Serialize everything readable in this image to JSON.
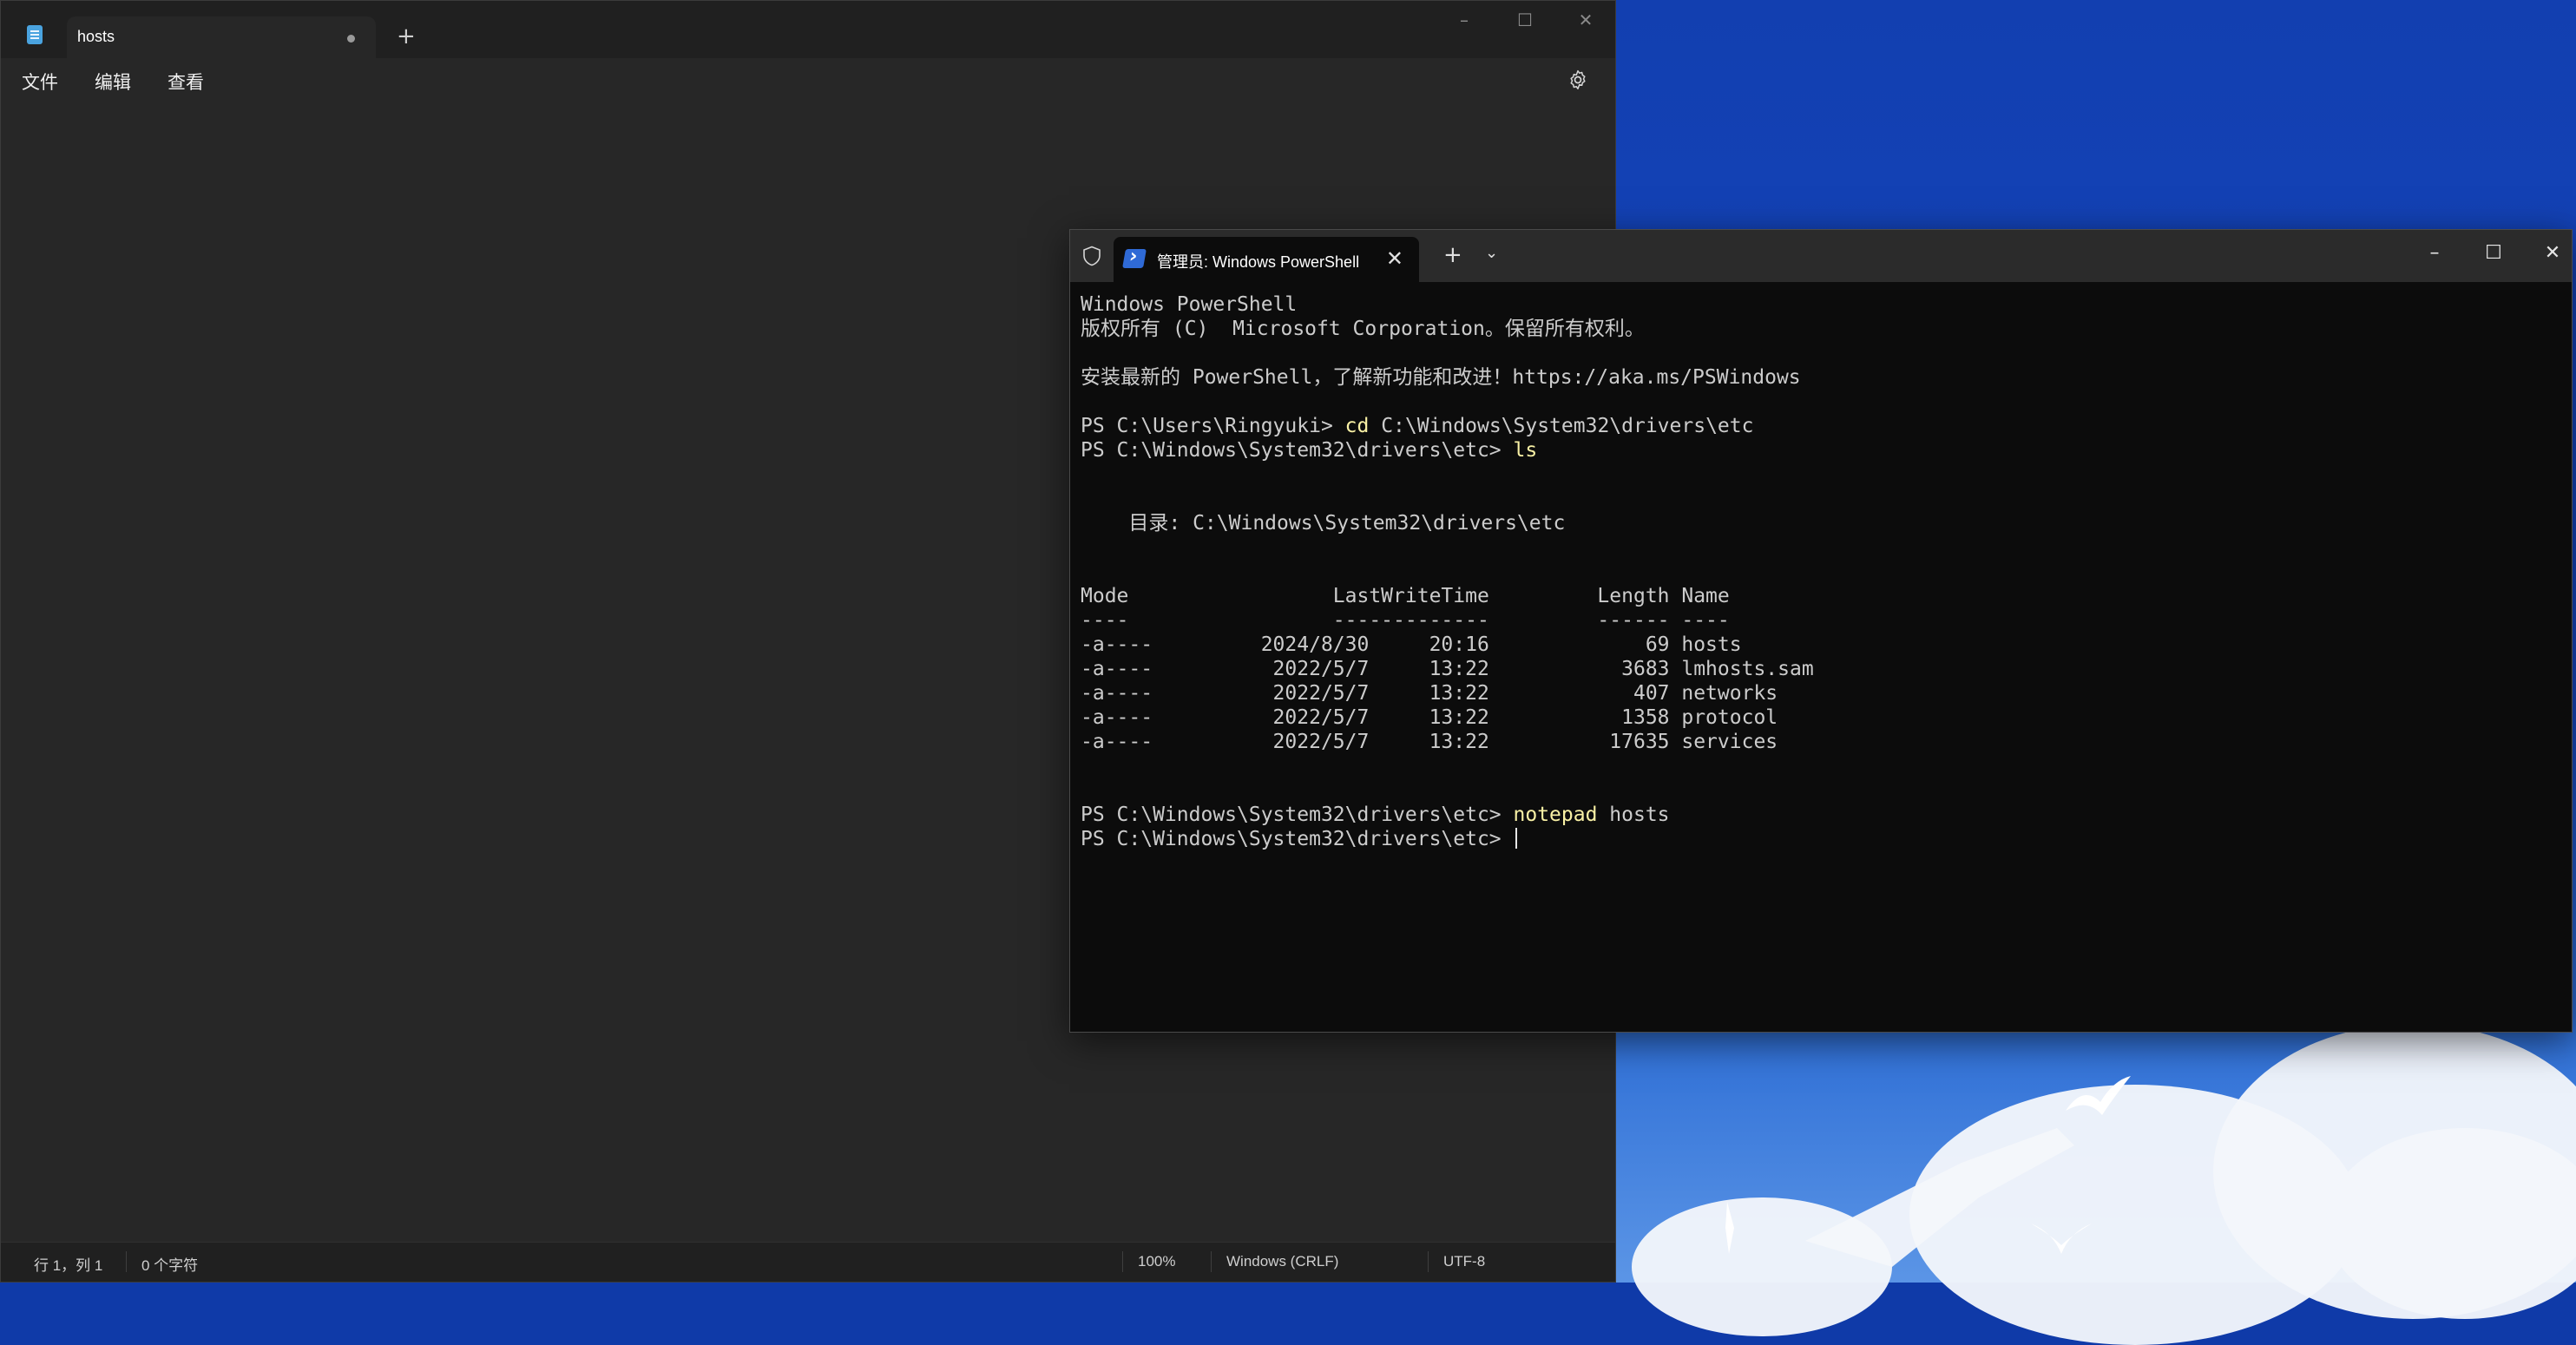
{
  "notepad": {
    "tab_title": "hosts",
    "menu": [
      "文件",
      "编辑",
      "查看"
    ],
    "status": {
      "position": "行 1，列 1",
      "char_count": "0 个字符",
      "zoom": "100%",
      "line_ending": "Windows (CRLF)",
      "encoding": "UTF-8"
    }
  },
  "terminal": {
    "tab_title": "管理员: Windows PowerShell",
    "lines": [
      {
        "text": "Windows PowerShell"
      },
      {
        "text": "版权所有 (C)  Microsoft Corporation。保留所有权利。"
      },
      {
        "text": ""
      },
      {
        "text": "安装最新的 PowerShell，了解新功能和改进！https://aka.ms/PSWindows"
      },
      {
        "text": ""
      },
      {
        "prompt": "PS C:\\Users\\Ringyuki> ",
        "cmd": "cd",
        "args": " C:\\Windows\\System32\\drivers\\etc"
      },
      {
        "prompt": "PS C:\\Windows\\System32\\drivers\\etc> ",
        "cmd": "ls",
        "args": ""
      },
      {
        "text": ""
      },
      {
        "text": ""
      },
      {
        "text": "    目录: C:\\Windows\\System32\\drivers\\etc"
      },
      {
        "text": ""
      },
      {
        "text": ""
      },
      {
        "text": "Mode                 LastWriteTime         Length Name"
      },
      {
        "text": "----                 -------------         ------ ----"
      },
      {
        "text": "-a----         2024/8/30     20:16             69 hosts"
      },
      {
        "text": "-a----          2022/5/7     13:22           3683 lmhosts.sam"
      },
      {
        "text": "-a----          2022/5/7     13:22            407 networks"
      },
      {
        "text": "-a----          2022/5/7     13:22           1358 protocol"
      },
      {
        "text": "-a----          2022/5/7     13:22          17635 services"
      },
      {
        "text": ""
      },
      {
        "text": ""
      },
      {
        "prompt": "PS C:\\Windows\\System32\\drivers\\etc> ",
        "cmd": "notepad",
        "args": " hosts"
      },
      {
        "prompt": "PS C:\\Windows\\System32\\drivers\\etc> ",
        "cmd": "",
        "args": "",
        "cursor": true
      }
    ]
  },
  "icons": {
    "notepad_app": "notepad-icon",
    "settings": "gear-icon",
    "shield": "shield-icon",
    "powershell": "powershell-icon",
    "new_tab": "plus-icon",
    "minimize": "minimize-icon",
    "maximize": "maximize-icon",
    "close": "close-icon",
    "dropdown": "chevron-down-icon"
  },
  "colors": {
    "notepad_bg": "#272727",
    "terminal_bg": "#0c0c0c",
    "command_highlight": "#f9f1a5",
    "desktop_blue": "#1647bf"
  }
}
